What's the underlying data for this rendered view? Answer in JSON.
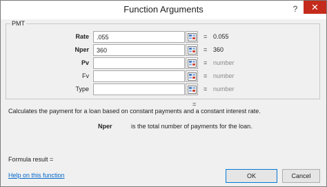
{
  "window": {
    "title": "Function Arguments",
    "help_glyph": "?",
    "close_glyph": "✕"
  },
  "function": {
    "name": "PMT",
    "args": [
      {
        "label": "Rate",
        "bold": true,
        "value": ".055",
        "eq": "=",
        "result": "0.055",
        "muted": false
      },
      {
        "label": "Nper",
        "bold": true,
        "value": "360",
        "eq": "=",
        "result": "360",
        "muted": false
      },
      {
        "label": "Pv",
        "bold": true,
        "value": "",
        "eq": "=",
        "result": "number",
        "muted": true
      },
      {
        "label": "Fv",
        "bold": false,
        "value": "",
        "eq": "=",
        "result": "number",
        "muted": true
      },
      {
        "label": "Type",
        "bold": false,
        "value": "",
        "eq": "=",
        "result": "number",
        "muted": true
      }
    ],
    "result_eq": "=",
    "description": "Calculates the payment for a loan based on constant payments and a constant interest rate.",
    "param_help": {
      "name": "Nper",
      "text": "is the total number of payments for the loan."
    }
  },
  "footer": {
    "formula_result": "Formula result =",
    "help_link": "Help on this function",
    "ok": "OK",
    "cancel": "Cancel"
  },
  "icons": {
    "ref_button": "collapse-dialog-icon"
  }
}
